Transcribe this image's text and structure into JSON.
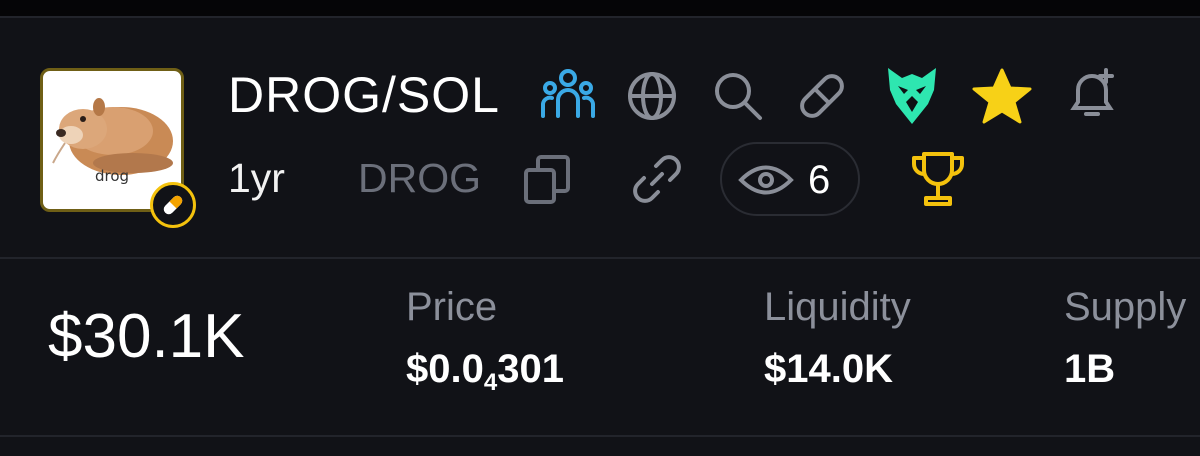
{
  "token": {
    "pair": "DROG/SOL",
    "age": "1yr",
    "symbol": "DROG",
    "avatar_caption": "drog",
    "watchers": "6"
  },
  "stats": {
    "market_cap": "$30.1K",
    "price": {
      "label": "Price",
      "prefix": "$0.0",
      "zeros_subscript": "4",
      "digits": "301"
    },
    "liquidity": {
      "label": "Liquidity",
      "value": "$14.0K"
    },
    "supply": {
      "label": "Supply",
      "value": "1B"
    }
  },
  "icons": {
    "community": "community-icon",
    "website": "globe-icon",
    "search": "search-icon",
    "pill": "pill-icon",
    "eagle": "eagle-icon",
    "favorite": "star-icon",
    "alert": "bell-plus-icon",
    "copy": "copy-icon",
    "link": "link-icon",
    "watch": "eye-icon",
    "trophy": "trophy-icon",
    "badge": "pill-badge-icon"
  },
  "colors": {
    "background": "#111217",
    "community": "#3aa9e6",
    "eagle": "#2ee6b0",
    "star": "#f7d117",
    "trophy": "#f4c20d",
    "muted_icon": "#8a8e98",
    "label": "#8c909b"
  }
}
